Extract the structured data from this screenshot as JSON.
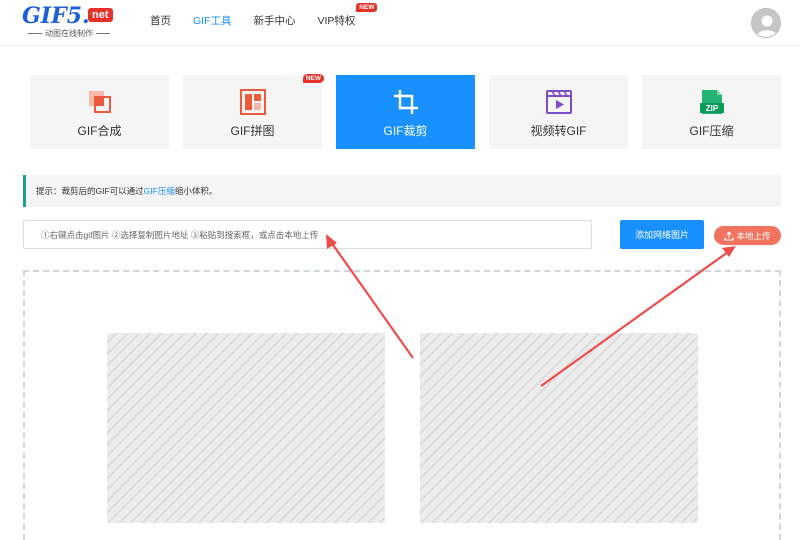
{
  "header": {
    "logo": {
      "main": "GIF5.",
      "net": "net",
      "tagline": "动图在线制作"
    },
    "nav": [
      {
        "label": "首页",
        "active": false
      },
      {
        "label": "GIF工具",
        "active": true
      },
      {
        "label": "新手中心",
        "active": false
      },
      {
        "label": "VIP特权",
        "active": false,
        "badge": "NEW"
      }
    ],
    "avatar_icon": "user-avatar-icon"
  },
  "tools": [
    {
      "label": "GIF合成",
      "icon": "gif-merge-icon",
      "active": false
    },
    {
      "label": "GIF拼图",
      "icon": "gif-collage-icon",
      "active": false,
      "badge": "NEW"
    },
    {
      "label": "GIF裁剪",
      "icon": "crop-icon",
      "active": true
    },
    {
      "label": "视频转GIF",
      "icon": "video-to-gif-icon",
      "active": false
    },
    {
      "label": "GIF压缩",
      "icon": "zip-icon",
      "active": false,
      "zip_text": "ZIP"
    }
  ],
  "tip": {
    "prefix": "提示：裁剪后的GIF可以通过",
    "link": "GIF压缩",
    "suffix": "缩小体积。"
  },
  "url_input": {
    "placeholder": "①右键点击gif图片 ②选择复制图片地址 ③粘贴到搜索框，或点击本地上传"
  },
  "buttons": {
    "add_network": "添加网络图片",
    "upload_local": "本地上传"
  },
  "colors": {
    "accent": "#1890ff",
    "upload": "#f2735f",
    "badge": "#e8302a",
    "annotation_arrow": "#ef4b4b"
  }
}
